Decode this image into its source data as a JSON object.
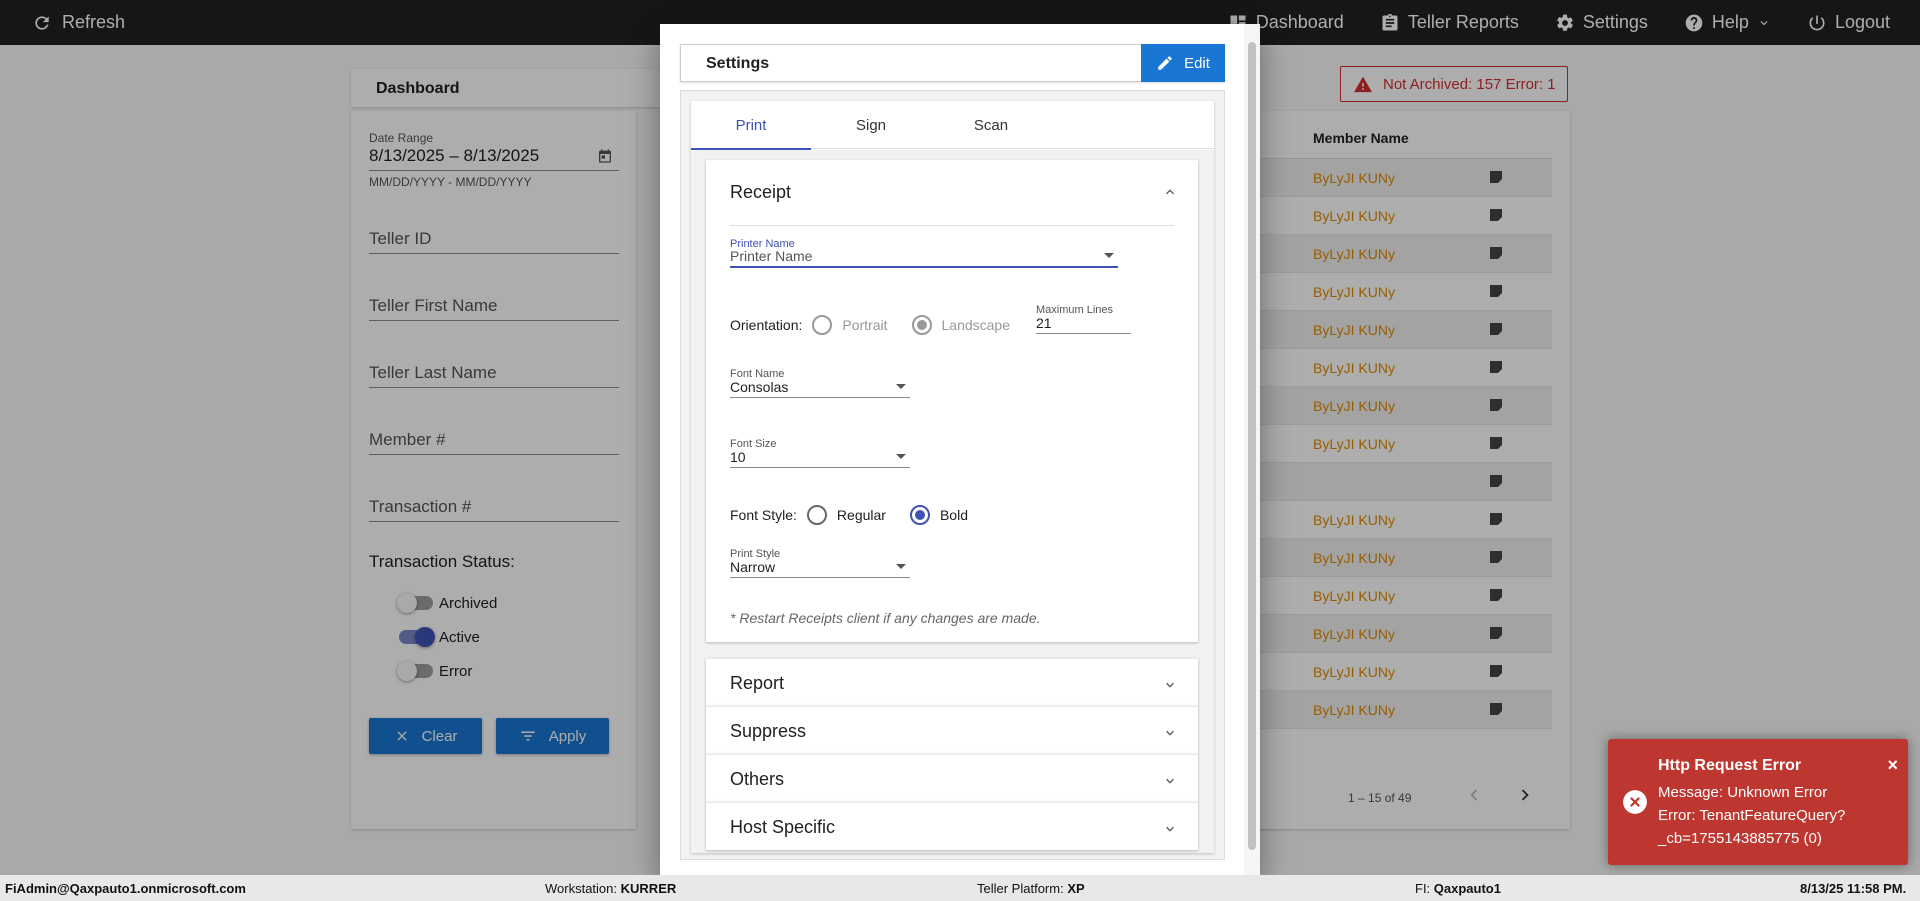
{
  "topbar": {
    "refresh_label": "Refresh",
    "nav": [
      {
        "label": "Dashboard",
        "icon": "dashboard-icon"
      },
      {
        "label": "Teller Reports",
        "icon": "clipboard-icon"
      },
      {
        "label": "Settings",
        "icon": "gear-icon"
      },
      {
        "label": "Help",
        "icon": "help-icon"
      },
      {
        "label": "Logout",
        "icon": "power-icon"
      }
    ]
  },
  "dashboard": {
    "title": "Dashboard",
    "filters": {
      "date_range_label": "Date Range",
      "date_range_value": "8/13/2025 – 8/13/2025",
      "date_hint": "MM/DD/YYYY - MM/DD/YYYY",
      "teller_id": "Teller ID",
      "teller_first": "Teller First Name",
      "teller_last": "Teller Last Name",
      "member": "Member #",
      "transaction": "Transaction #",
      "status_title": "Transaction Status:",
      "toggles": [
        {
          "label": "Archived",
          "on": false
        },
        {
          "label": "Active",
          "on": true
        },
        {
          "label": "Error",
          "on": false
        }
      ],
      "clear_label": "Clear",
      "apply_label": "Apply"
    },
    "alert": "Not Archived: 157  Error: 1",
    "table": {
      "header": "Member Name",
      "rows": [
        "ByLyJI KUNy",
        "ByLyJI KUNy",
        "ByLyJI KUNy",
        "ByLyJI KUNy",
        "ByLyJI KUNy",
        "ByLyJI KUNy",
        "ByLyJI KUNy",
        "ByLyJI KUNy",
        "",
        "ByLyJI KUNy",
        "ByLyJI KUNy",
        "ByLyJI KUNy",
        "ByLyJI KUNy",
        "ByLyJI KUNy",
        "ByLyJI KUNy"
      ],
      "pager": "1 – 15 of 49"
    }
  },
  "modal": {
    "title": "Settings",
    "edit_label": "Edit",
    "tabs": [
      "Print",
      "Sign",
      "Scan"
    ],
    "receipt": {
      "title": "Receipt",
      "printer_label": "Printer Name",
      "printer_value": "Printer Name",
      "orientation_label": "Orientation:",
      "portrait": "Portrait",
      "landscape": "Landscape",
      "max_lines_label": "Maximum Lines",
      "max_lines_value": "21",
      "font_name_label": "Font Name",
      "font_name_value": "Consolas",
      "font_size_label": "Font Size",
      "font_size_value": "10",
      "font_style_label": "Font Style:",
      "regular": "Regular",
      "bold": "Bold",
      "print_style_label": "Print Style",
      "print_style_value": "Narrow",
      "restart_note": "* Restart Receipts client if any changes are made."
    },
    "sections": [
      "Report",
      "Suppress",
      "Others",
      "Host Specific"
    ]
  },
  "toast": {
    "title": "Http Request Error",
    "message_line1": "Message: Unknown Error",
    "message_line2": "Error: TenantFeatureQuery?_cb=1755143885775 (0)"
  },
  "statusbar": {
    "user": "FiAdmin@Qaxpauto1.onmicrosoft.com",
    "workstation_label": "Workstation:",
    "workstation": "KURRER",
    "platform_label": "Teller Platform:",
    "platform": "XP",
    "fi_label": "FI:",
    "fi": "Qaxpauto1",
    "datetime": "8/13/25 11:58 PM."
  },
  "colors": {
    "accent": "#3f51b5",
    "primary_button": "#1976d2",
    "error": "#d32f2f",
    "toast": "#bd362f",
    "member_name": "#e08a00"
  }
}
